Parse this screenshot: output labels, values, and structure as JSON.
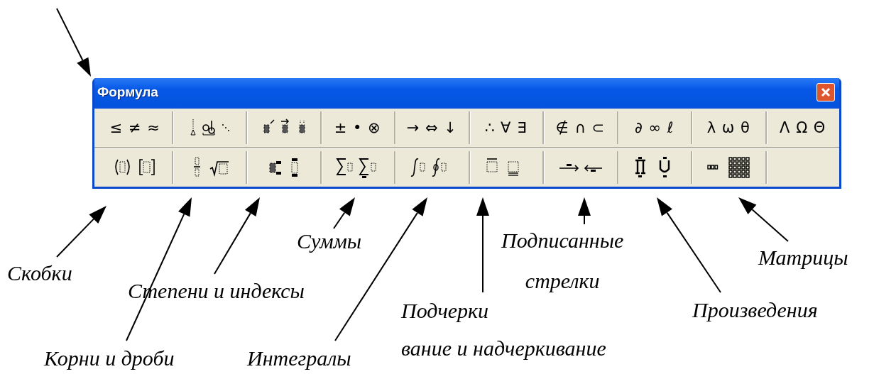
{
  "window": {
    "title": "Формула"
  },
  "palette_rows": [
    [
      {
        "kind": "symbols",
        "text": "≤ ≠ ≈"
      },
      {
        "kind": "spaces"
      },
      {
        "kind": "embellishments"
      },
      {
        "kind": "symbols",
        "text": "± • ⊗"
      },
      {
        "kind": "symbols",
        "text": "→ ⇔ ↓"
      },
      {
        "kind": "symbols",
        "text": "∴ ∀ ∃"
      },
      {
        "kind": "symbols",
        "text": "∉ ∩ ⊂"
      },
      {
        "kind": "symbols",
        "text": "∂ ∞ ℓ"
      },
      {
        "kind": "symbols",
        "text": "λ ω θ"
      },
      {
        "kind": "symbols",
        "text": "Λ Ω Θ"
      }
    ],
    [
      {
        "kind": "fences"
      },
      {
        "kind": "fractions"
      },
      {
        "kind": "scripts"
      },
      {
        "kind": "sums"
      },
      {
        "kind": "integrals"
      },
      {
        "kind": "bars"
      },
      {
        "kind": "arrows"
      },
      {
        "kind": "products"
      },
      {
        "kind": "matrices"
      },
      {
        "kind": "empty"
      }
    ]
  ],
  "callouts": [
    {
      "lines": [
        "Суммы"
      ]
    },
    {
      "lines": [
        "Подписанные",
        "стрелки"
      ]
    },
    {
      "lines": [
        "Матрицы"
      ]
    },
    {
      "lines": [
        "Скобки"
      ]
    },
    {
      "lines": [
        "Степени и индексы"
      ]
    },
    {
      "lines": [
        "Подчерки",
        "вание и надчеркивание"
      ]
    },
    {
      "lines": [
        "Произведения"
      ]
    },
    {
      "lines": [
        "Корни и дроби"
      ]
    },
    {
      "lines": [
        "Интегралы"
      ]
    }
  ]
}
